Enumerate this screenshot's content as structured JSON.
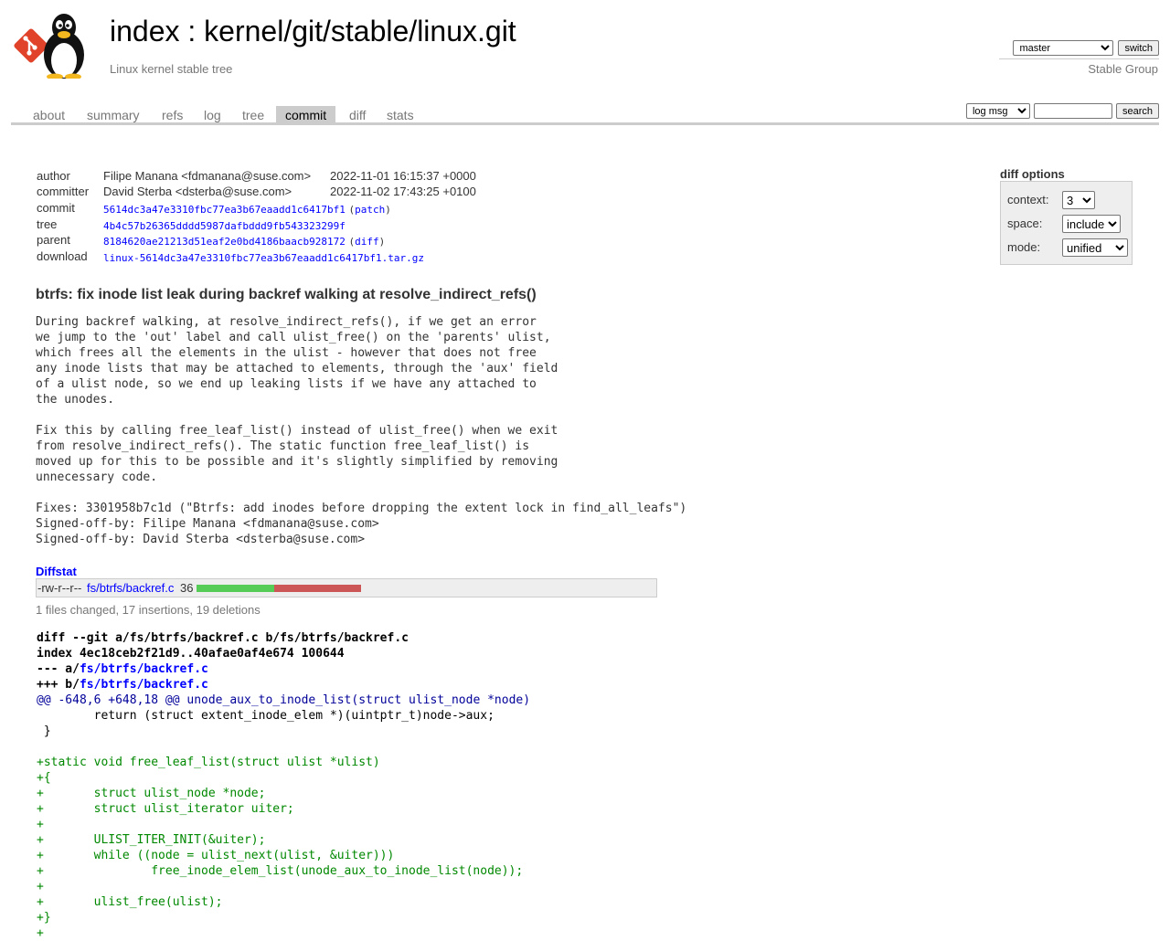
{
  "header": {
    "title_index": "index",
    "title_sep": " : ",
    "title_repo": "kernel/git/stable/linux.git",
    "description": "Linux kernel stable tree",
    "owner": "Stable Group",
    "branch_selected": "master",
    "switch_label": "switch"
  },
  "tabs": [
    "about",
    "summary",
    "refs",
    "log",
    "tree",
    "commit",
    "diff",
    "stats"
  ],
  "active_tab": "commit",
  "search": {
    "mode_selected": "log msg",
    "query": "",
    "button_label": "search"
  },
  "commit_info": {
    "author_label": "author",
    "author_value": "Filipe Manana <fdmanana@suse.com>",
    "author_date": "2022-11-01 16:15:37 +0000",
    "committer_label": "committer",
    "committer_value": "David Sterba <dsterba@suse.com>",
    "committer_date": "2022-11-02 17:43:25 +0100",
    "commit_label": "commit",
    "commit_sha": "5614dc3a47e3310fbc77ea3b67eaadd1c6417bf1",
    "commit_link_patch": "patch",
    "tree_label": "tree",
    "tree_sha": "4b4c57b26365dddd5987dafbddd9fb543323299f",
    "parent_label": "parent",
    "parent_sha": "8184620ae21213d51eaf2e0bd4186baacb928172",
    "parent_link_diff": "diff",
    "download_label": "download",
    "download_link": "linux-5614dc3a47e3310fbc77ea3b67eaadd1c6417bf1.tar.gz"
  },
  "diff_options": {
    "title": "diff options",
    "context_label": "context:",
    "context_value": "3",
    "space_label": "space:",
    "space_value": "include",
    "mode_label": "mode:",
    "mode_value": "unified"
  },
  "commit_subject": "btrfs: fix inode list leak during backref walking at resolve_indirect_refs()",
  "commit_message": "During backref walking, at resolve_indirect_refs(), if we get an error\nwe jump to the 'out' label and call ulist_free() on the 'parents' ulist,\nwhich frees all the elements in the ulist - however that does not free\nany inode lists that may be attached to elements, through the 'aux' field\nof a ulist node, so we end up leaking lists if we have any attached to\nthe unodes.\n\nFix this by calling free_leaf_list() instead of ulist_free() when we exit\nfrom resolve_indirect_refs(). The static function free_leaf_list() is\nmoved up for this to be possible and it's slightly simplified by removing\nunnecessary code.\n\nFixes: 3301958b7c1d (\"Btrfs: add inodes before dropping the extent lock in find_all_leafs\")\nSigned-off-by: Filipe Manana <fdmanana@suse.com>\nSigned-off-by: David Sterba <dsterba@suse.com>",
  "diffstat": {
    "header": "Diffstat",
    "mode": "-rw-r--r--",
    "file": "fs/btrfs/backref.c",
    "changes": "36",
    "insertions": 17,
    "deletions": 19,
    "summary": "1 files changed, 17 insertions, 19 deletions"
  },
  "diff": {
    "head_diff_prefix": "diff --git a/fs/btrfs/backref.c b/fs/btrfs/backref.c",
    "head_index": "index 4ec18ceb2f21d9..40afae0af4e674 100644",
    "head_minus_prefix": "--- a/",
    "head_plus_prefix": "+++ b/",
    "head_file": "fs/btrfs/backref.c",
    "hunk_range": "@@ -648,6 +648,18 @@ ",
    "hunk_function": "unode_aux_to_inode_list(struct ulist_node *node)",
    "lines": [
      {
        "type": "ctx",
        "text": "        return (struct extent_inode_elem *)(uintptr_t)node->aux;"
      },
      {
        "type": "ctx",
        "text": " }"
      },
      {
        "type": "ctx",
        "text": " "
      },
      {
        "type": "add",
        "text": "+static void free_leaf_list(struct ulist *ulist)"
      },
      {
        "type": "add",
        "text": "+{"
      },
      {
        "type": "add",
        "text": "+       struct ulist_node *node;"
      },
      {
        "type": "add",
        "text": "+       struct ulist_iterator uiter;"
      },
      {
        "type": "add",
        "text": "+"
      },
      {
        "type": "add",
        "text": "+       ULIST_ITER_INIT(&uiter);"
      },
      {
        "type": "add",
        "text": "+       while ((node = ulist_next(ulist, &uiter)))"
      },
      {
        "type": "add",
        "text": "+               free_inode_elem_list(unode_aux_to_inode_list(node));"
      },
      {
        "type": "add",
        "text": "+"
      },
      {
        "type": "add",
        "text": "+       ulist_free(ulist);"
      },
      {
        "type": "add",
        "text": "+}"
      },
      {
        "type": "add",
        "text": "+"
      }
    ]
  },
  "colors": {
    "link": "#0000ff",
    "added": "#008800",
    "hunk": "#000099",
    "bar_insert": "#55cc55",
    "bar_delete": "#cc5555",
    "tab_active_bg": "#cccccc",
    "logo_red": "#e0432a"
  }
}
